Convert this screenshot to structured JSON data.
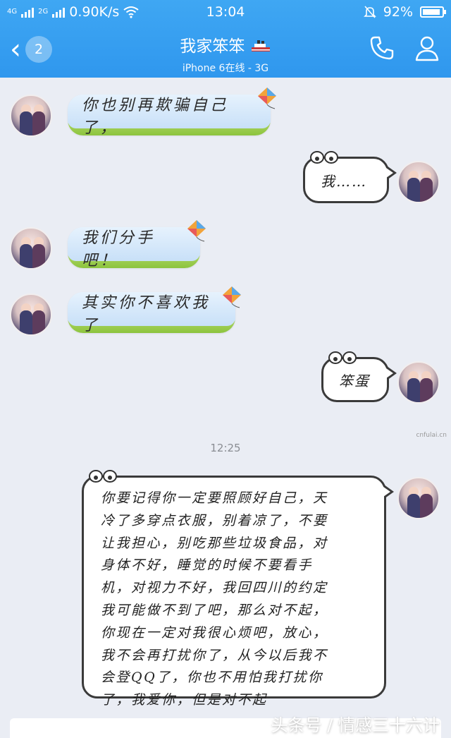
{
  "status_bar": {
    "network_1": "4G",
    "network_2": "2G",
    "speed": "0.90K/s",
    "time": "13:04",
    "battery": "92%"
  },
  "header": {
    "unread_count": "2",
    "title": "我家笨笨",
    "subtitle": "iPhone 6在线 - 3G",
    "bg_color": "#3a9ff0"
  },
  "messages": [
    {
      "side": "in",
      "text": "你也别再欺骗自己了，"
    },
    {
      "side": "out",
      "text": "我……"
    },
    {
      "side": "in",
      "text": "我们分手吧！"
    },
    {
      "side": "in",
      "text": "其实你不喜欢我了"
    },
    {
      "side": "out",
      "text": "笨蛋"
    },
    {
      "side": "out",
      "lines": [
        "你要记得你一定要照顾好自己，天",
        "冷了多穿点衣服，别着凉了，不要",
        "让我担心，别吃那些垃圾食品，对",
        "身体不好，睡觉的时候不要看手",
        "机，对视力不好，我回四川的约定",
        "我可能做不到了吧，那么对不起，",
        "你现在一定对我很心烦吧，放心，",
        "我不会再打扰你了，从今以后我不",
        "会登QQ了，你也不用怕我打扰你",
        "了，我爱你，但是对不起"
      ]
    }
  ],
  "timestamp": "12:25",
  "watermark": "cnfulai.cn",
  "footer_mark": "头条号 / 情感三十六计"
}
